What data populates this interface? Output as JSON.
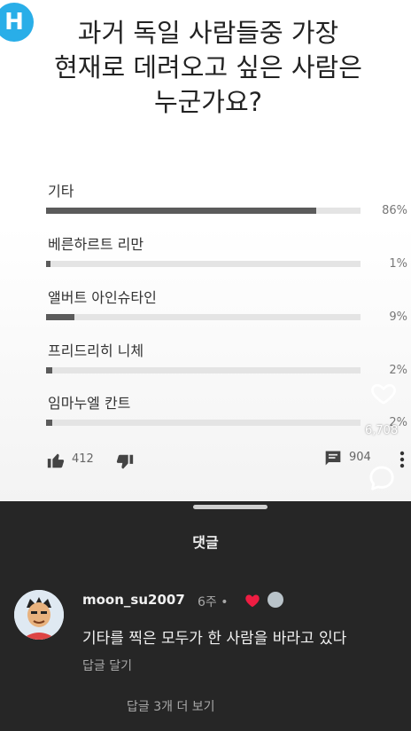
{
  "app": {
    "logo_letter": "H"
  },
  "poll": {
    "question_lines": [
      "과거 독일 사람들중 가장",
      "현재로 데려오고 싶은 사람은",
      "누군가요?"
    ],
    "options": [
      {
        "label": "기타",
        "percent_text": "86%",
        "fraction": 0.86
      },
      {
        "label": "베른하르트 리만",
        "percent_text": "1%",
        "fraction": 0.01
      },
      {
        "label": "앨버트 아인슈타인",
        "percent_text": "9%",
        "fraction": 0.09
      },
      {
        "label": "프리드리히 니체",
        "percent_text": "2%",
        "fraction": 0.02
      },
      {
        "label": "임마누엘 칸트",
        "percent_text": "2%",
        "fraction": 0.02
      }
    ],
    "likes": "412",
    "comments": "904",
    "favorite_count": "6,708"
  },
  "comments_sheet": {
    "title": "댓글",
    "comment": {
      "username": "moon_su2007",
      "time": "6주",
      "separator": "•",
      "text": "기타를 찍은 모두가 한 사람을 바라고 있다",
      "reply_label": "답글 달기"
    },
    "view_more": "답글 3개 더 보기"
  },
  "colors": {
    "sheet_bg": "#262626",
    "bar_fill": "#5b5b5b",
    "bar_track": "#e4e4e4",
    "logo": "#29aee8",
    "heart_red": "#ee1d42"
  },
  "icons": [
    "logo-icon",
    "heart-outline-icon",
    "comment-bubble-icon",
    "thumbs-up-icon",
    "thumbs-down-icon",
    "comment-icon",
    "more-vertical-icon",
    "red-heart-icon"
  ]
}
